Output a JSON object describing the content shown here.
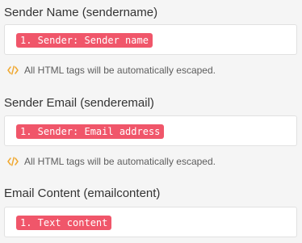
{
  "fields": [
    {
      "label": "Sender Name (sendername)",
      "token": "1. Sender: Sender name",
      "hint": "All HTML tags will be automatically escaped."
    },
    {
      "label": "Sender Email (senderemail)",
      "token": "1. Sender: Email address",
      "hint": "All HTML tags will be automatically escaped."
    },
    {
      "label": "Email Content (emailcontent)",
      "token": "1. Text content"
    }
  ],
  "icons": {
    "hint_icon": "code-icon"
  },
  "colors": {
    "token_background": "#f0566a",
    "token_text": "#ffffff",
    "hint_icon": "#f0a830",
    "label_text": "#333333",
    "page_background": "#f5f5f5"
  }
}
